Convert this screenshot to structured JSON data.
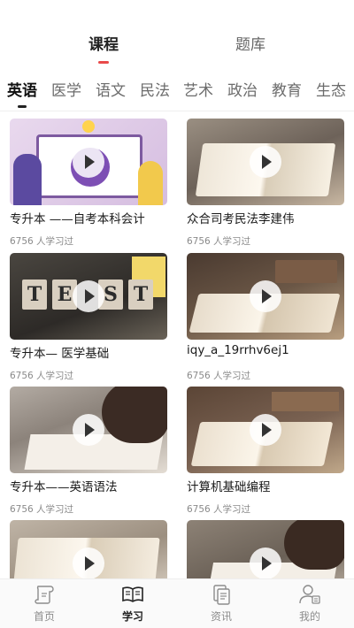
{
  "top_tabs": [
    {
      "label": "课程",
      "active": true
    },
    {
      "label": "题库",
      "active": false
    }
  ],
  "categories": [
    {
      "label": "英语",
      "active": true
    },
    {
      "label": "医学"
    },
    {
      "label": "语文"
    },
    {
      "label": "民法"
    },
    {
      "label": "艺术"
    },
    {
      "label": "政治"
    },
    {
      "label": "教育"
    },
    {
      "label": "生态"
    }
  ],
  "courses": [
    {
      "title": "专升本 ——自考本科会计",
      "learners": "6756 人学习过"
    },
    {
      "title": "众合司考民法李建伟",
      "learners": "6756 人学习过"
    },
    {
      "title": "专升本— 医学基础",
      "learners": "6756 人学习过"
    },
    {
      "title": "iqy_a_19rrhv6ej1",
      "learners": "6756 人学习过"
    },
    {
      "title": "专升本——英语语法",
      "learners": "6756 人学习过"
    },
    {
      "title": "计算机基础编程",
      "learners": "6756 人学习过"
    }
  ],
  "thumb_text": {
    "test_letters": [
      "T",
      "E",
      "S",
      "T"
    ]
  },
  "bottom_nav": [
    {
      "label": "首页",
      "icon": "home-scroll-icon",
      "active": false
    },
    {
      "label": "学习",
      "icon": "open-book-icon",
      "active": true
    },
    {
      "label": "资讯",
      "icon": "news-document-icon",
      "active": false
    },
    {
      "label": "我的",
      "icon": "profile-icon",
      "active": false
    }
  ],
  "colors": {
    "accent": "#e94a4a",
    "text_primary": "#222222",
    "text_secondary": "#8a8a8a"
  }
}
